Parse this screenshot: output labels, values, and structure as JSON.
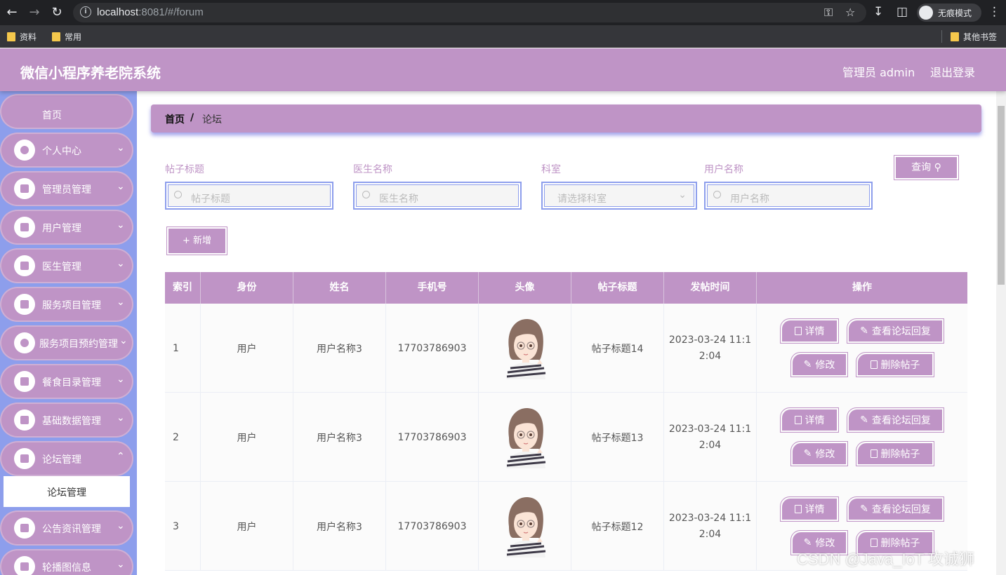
{
  "browser": {
    "url_host": "localhost",
    "url_rest": ":8081/#/forum",
    "incognito_label": "无痕模式",
    "bookmarks": [
      "资料",
      "常用"
    ],
    "other_bookmarks": "其他书签"
  },
  "app": {
    "title": "微信小程序养老院系统",
    "admin_label": "管理员 admin",
    "logout_label": "退出登录"
  },
  "sidebar": {
    "home": "首页",
    "items": [
      {
        "label": "个人中心"
      },
      {
        "label": "管理员管理"
      },
      {
        "label": "用户管理"
      },
      {
        "label": "医生管理"
      },
      {
        "label": "服务项目管理"
      },
      {
        "label": "服务项目预约管理"
      },
      {
        "label": "餐食目录管理"
      },
      {
        "label": "基础数据管理"
      },
      {
        "label": "论坛管理"
      },
      {
        "label": "公告资讯管理"
      },
      {
        "label": "轮播图信息"
      }
    ],
    "active_sub": "论坛管理"
  },
  "breadcrumb": {
    "home": "首页",
    "separator": "/",
    "current": "论坛"
  },
  "filters": {
    "post_title": {
      "label": "帖子标题",
      "placeholder": "帖子标题"
    },
    "doctor_name": {
      "label": "医生名称",
      "placeholder": "医生名称"
    },
    "department": {
      "label": "科室",
      "placeholder": "请选择科室"
    },
    "user_name": {
      "label": "用户名称",
      "placeholder": "用户名称"
    },
    "query_button": "查询",
    "add_button": "新增"
  },
  "table": {
    "headers": [
      "索引",
      "身份",
      "姓名",
      "手机号",
      "头像",
      "帖子标题",
      "发帖时间",
      "操作"
    ],
    "rows": [
      {
        "index": "1",
        "role": "用户",
        "name": "用户名称3",
        "phone": "17703786903",
        "title": "帖子标题14",
        "time_a": "2023-03-24 11:1",
        "time_b": "2:04"
      },
      {
        "index": "2",
        "role": "用户",
        "name": "用户名称3",
        "phone": "17703786903",
        "title": "帖子标题13",
        "time_a": "2023-03-24 11:1",
        "time_b": "2:04"
      },
      {
        "index": "3",
        "role": "用户",
        "name": "用户名称3",
        "phone": "17703786903",
        "title": "帖子标题12",
        "time_a": "2023-03-24 11:1",
        "time_b": "2:04"
      }
    ],
    "actions": {
      "detail": "详情",
      "view_reply": "查看论坛回复",
      "edit": "修改",
      "delete": "删除帖子"
    }
  },
  "watermark": "CSDN @Java_IoT 攻诚狮"
}
